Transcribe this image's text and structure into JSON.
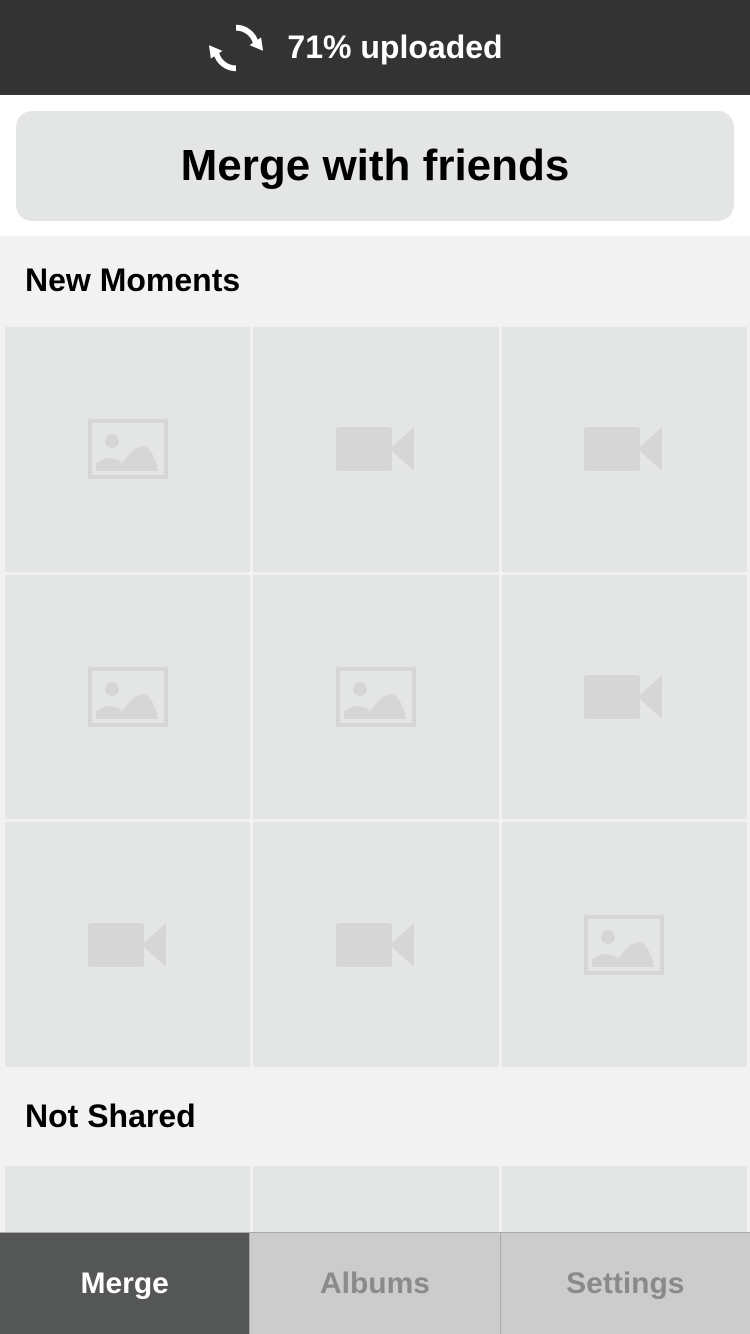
{
  "status": {
    "icon": "sync-icon",
    "upload_progress_percent": 71,
    "text": "71% uploaded"
  },
  "merge_button": {
    "label": "Merge with friends"
  },
  "sections": [
    {
      "title": "New Moments",
      "tiles": [
        {
          "type": "photo",
          "icon": "image-placeholder-icon"
        },
        {
          "type": "video",
          "icon": "video-camera-icon"
        },
        {
          "type": "video",
          "icon": "video-camera-icon"
        },
        {
          "type": "photo",
          "icon": "image-placeholder-icon"
        },
        {
          "type": "photo",
          "icon": "image-placeholder-icon"
        },
        {
          "type": "video",
          "icon": "video-camera-icon"
        },
        {
          "type": "video",
          "icon": "video-camera-icon"
        },
        {
          "type": "video",
          "icon": "video-camera-icon"
        },
        {
          "type": "photo",
          "icon": "image-placeholder-icon"
        }
      ]
    },
    {
      "title": "Not Shared",
      "tiles": [
        {
          "type": "blank"
        },
        {
          "type": "blank"
        },
        {
          "type": "blank"
        }
      ]
    }
  ],
  "tabs": [
    {
      "label": "Merge",
      "active": true
    },
    {
      "label": "Albums",
      "active": false
    },
    {
      "label": "Settings",
      "active": false
    }
  ],
  "colors": {
    "status_bar": "#333333",
    "tile": "#e4e5e5",
    "tile_icon": "#d6d6d6",
    "section_bg": "#f2f2f2",
    "tab_active": "#555757",
    "tab_inactive": "#cccccc",
    "tab_inactive_text": "#8a8a8a"
  }
}
